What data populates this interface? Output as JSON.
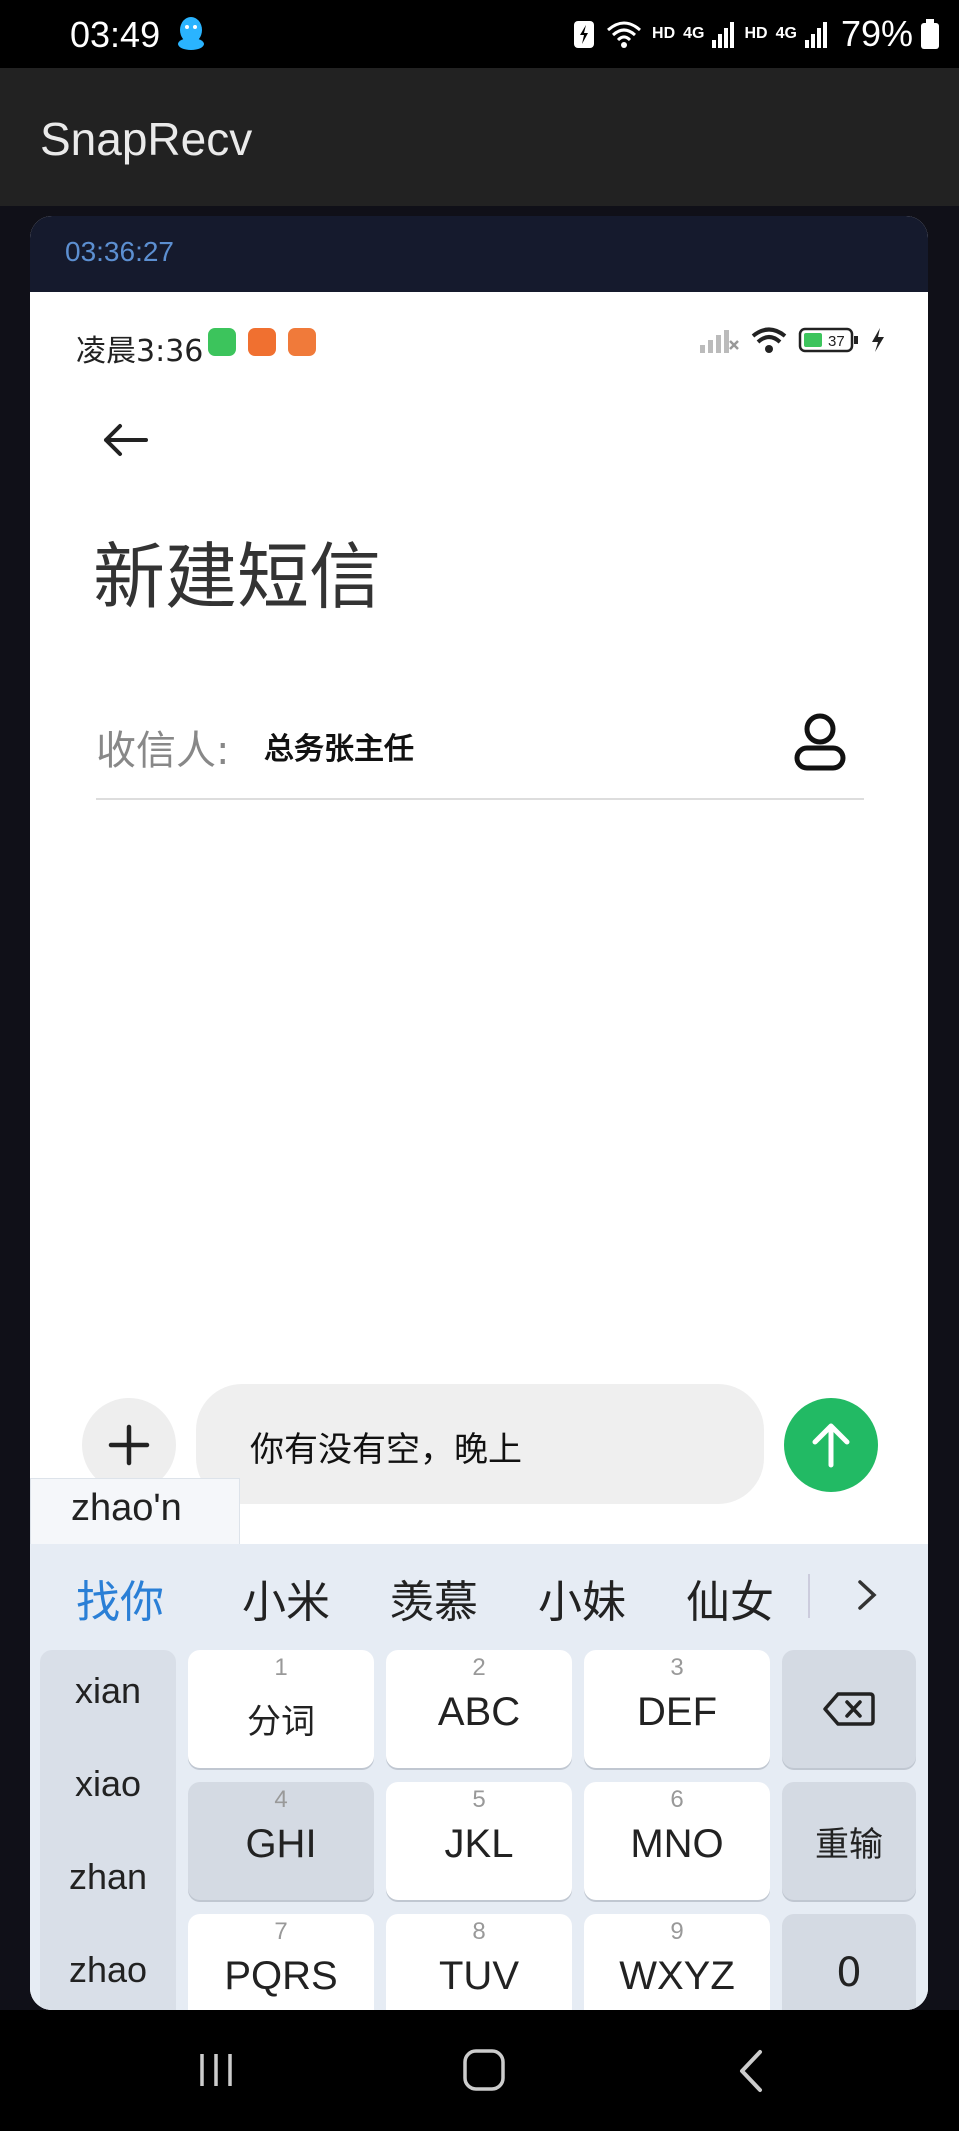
{
  "status_bar": {
    "time": "03:49",
    "hd1": "HD",
    "g1": "4G",
    "hd2": "HD",
    "g2": "4G",
    "battery": "79%"
  },
  "app": {
    "title": "SnapRecv"
  },
  "card": {
    "timestamp": "03:36:27"
  },
  "inner_status": {
    "time": "凌晨3:36",
    "battery": "37"
  },
  "compose": {
    "title": "新建短信",
    "recipient_label": "收信人:",
    "recipient_name": "总务张主任",
    "message_text": "你有没有空，晚上"
  },
  "ime": {
    "composing_pinyin": "zhao'n",
    "candidates": [
      "找你",
      "小米",
      "羡慕",
      "小妹",
      "仙女"
    ],
    "pinyin_options": [
      "xian",
      "xiao",
      "zhan",
      "zhao"
    ],
    "keys": [
      {
        "num": "1",
        "label": "分词"
      },
      {
        "num": "2",
        "label": "ABC"
      },
      {
        "num": "3",
        "label": "DEF"
      },
      {
        "num": "4",
        "label": "GHI"
      },
      {
        "num": "5",
        "label": "JKL"
      },
      {
        "num": "6",
        "label": "MNO"
      },
      {
        "num": "7",
        "label": "PQRS"
      },
      {
        "num": "8",
        "label": "TUV"
      },
      {
        "num": "9",
        "label": "WXYZ"
      }
    ],
    "reenter_label": "重输",
    "zero_label": "0"
  },
  "icons": {
    "back": "arrow-left-icon",
    "contact": "person-icon",
    "attach": "plus-icon",
    "send": "arrow-up-icon",
    "delete": "backspace-icon"
  },
  "colors": {
    "send": "#22ba64",
    "candidate_active": "#2a7fd6",
    "timestamp": "#5c8fd1"
  }
}
